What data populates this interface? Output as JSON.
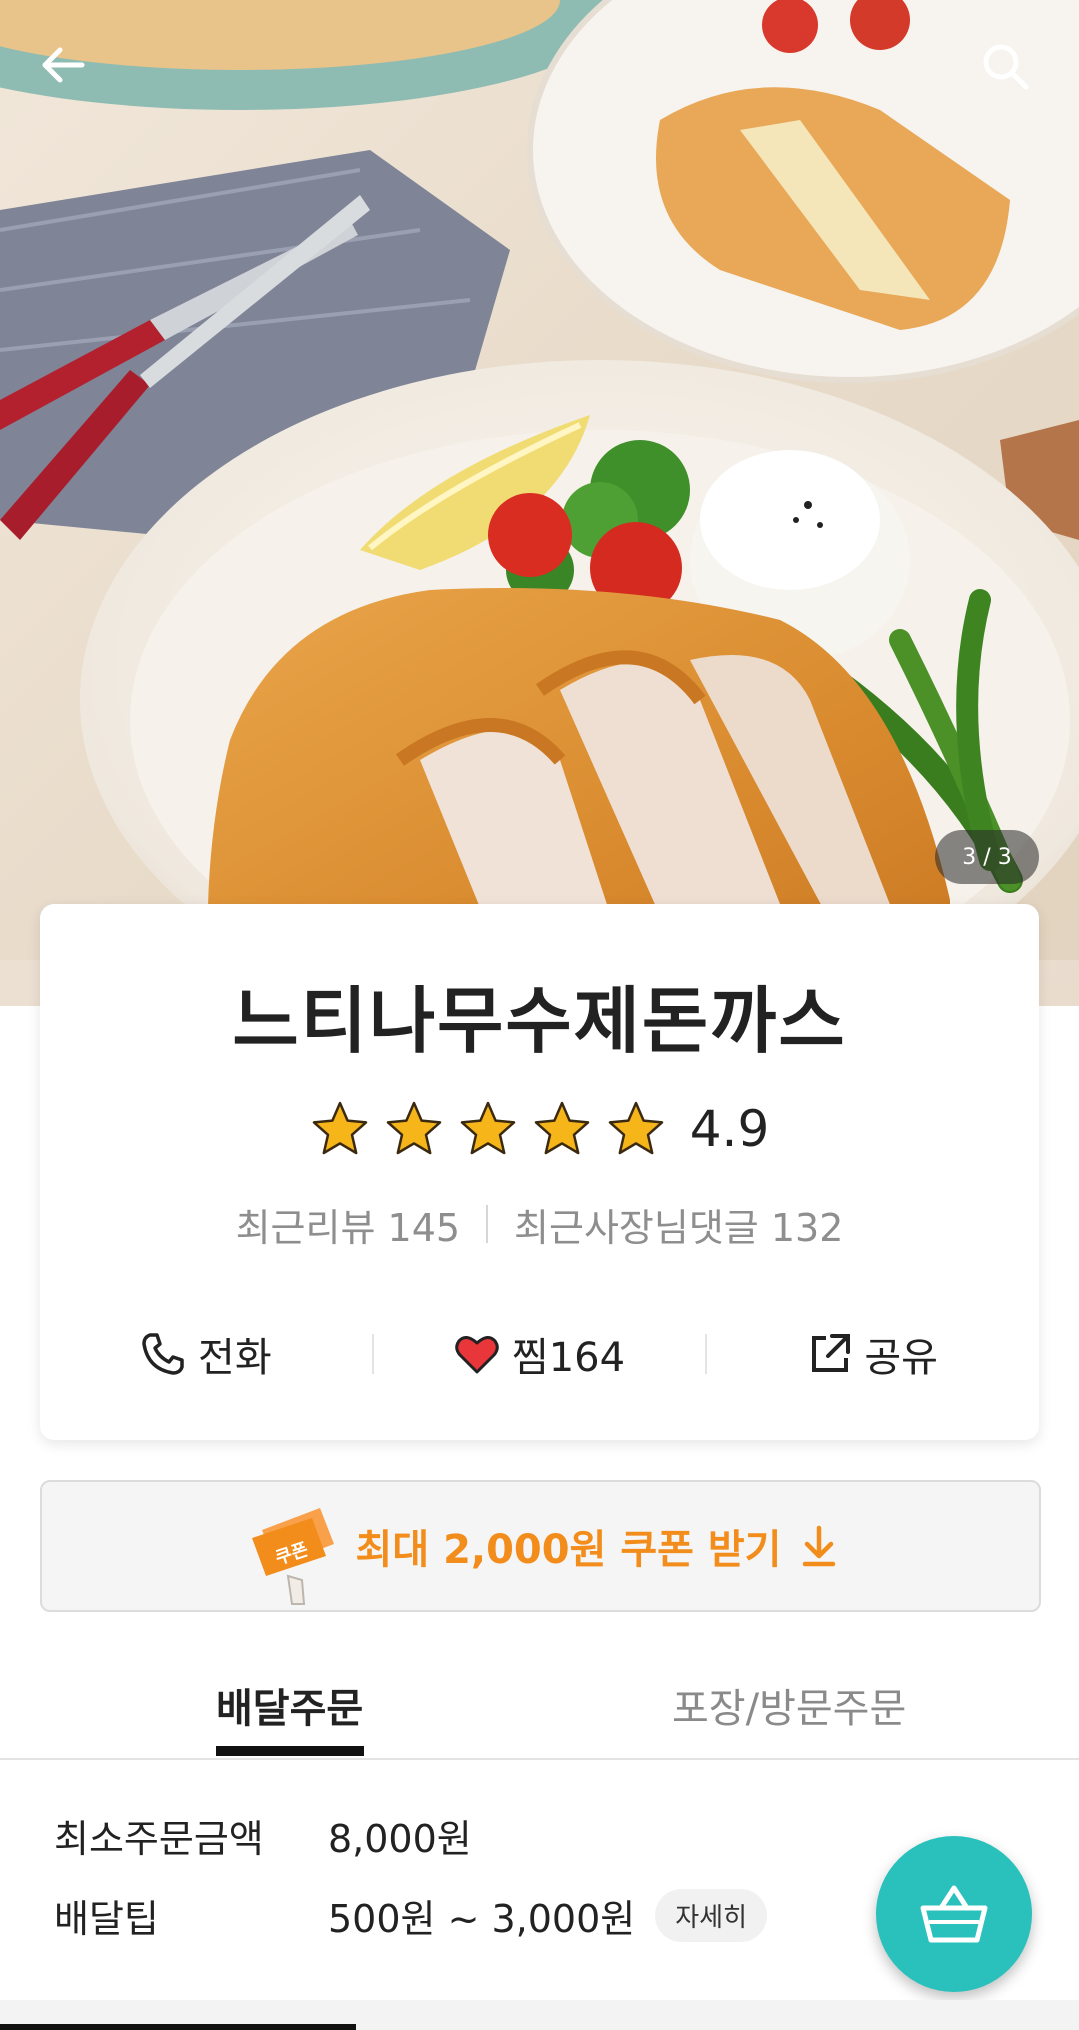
{
  "header": {
    "back_icon": "arrow-left-icon",
    "search_icon": "search-icon",
    "photo_counter": "3 / 3"
  },
  "store": {
    "name": "느티나무수제돈까스",
    "rating": "4.9",
    "stars_filled": 5,
    "stars_total": 5,
    "recent_reviews": "최근리뷰 145",
    "owner_replies": "최근사장님댓글 132"
  },
  "actions": {
    "call_label": "전화",
    "like_label": "찜164",
    "share_label": "공유"
  },
  "coupon": {
    "badge_text": "쿠폰",
    "label": "최대 2,000원 쿠폰 받기"
  },
  "tabs": [
    {
      "label": "배달주문",
      "active": true
    },
    {
      "label": "포장/방문주문",
      "active": false
    }
  ],
  "delivery_info": {
    "min_order_label": "최소주문금액",
    "min_order_value": "8,000원",
    "delivery_tip_label": "배달팁",
    "delivery_tip_value": "500원 ~ 3,000원",
    "detail_button": "자세히"
  },
  "colors": {
    "accent_orange": "#f28c1b",
    "cart_teal": "#2ac1bc",
    "star_yellow": "#f6b619",
    "heart_red": "#e8363b"
  },
  "cart_icon": "basket-icon"
}
